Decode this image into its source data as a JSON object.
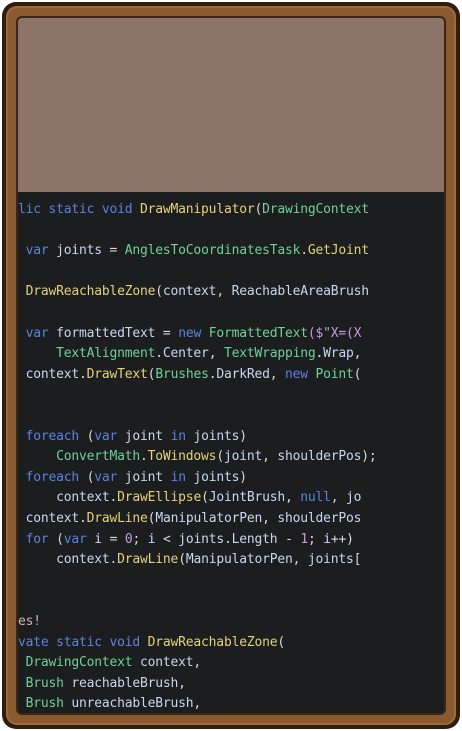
{
  "window": {
    "title": ""
  },
  "colors": {
    "frame": "#8a5a2e",
    "frame_dark": "#2f1e10",
    "header": "#8c7468",
    "code_bg": "#1b1d1e",
    "keyword": "#5b82e0",
    "type": "#6ed19a",
    "method": "#e3d27a",
    "identifier": "#c9d6f2",
    "plain": "#d8d8d8"
  },
  "code": {
    "lines": [
      {
        "segs": [
          {
            "t": "lic ",
            "c": "kw"
          },
          {
            "t": "static ",
            "c": "kw"
          },
          {
            "t": "void ",
            "c": "kw"
          },
          {
            "t": "DrawManipulator",
            "c": "meth"
          },
          {
            "t": "(",
            "c": "pl"
          },
          {
            "t": "DrawingContext",
            "c": "type"
          }
        ]
      },
      {
        "segs": [
          {
            "t": "",
            "c": "pl"
          }
        ]
      },
      {
        "segs": [
          {
            "t": " var ",
            "c": "kw"
          },
          {
            "t": "joints",
            "c": "id"
          },
          {
            "t": " = ",
            "c": "pl"
          },
          {
            "t": "AnglesToCoordinatesTask",
            "c": "type"
          },
          {
            "t": ".",
            "c": "pl"
          },
          {
            "t": "GetJoint",
            "c": "meth"
          }
        ]
      },
      {
        "segs": [
          {
            "t": "",
            "c": "pl"
          }
        ]
      },
      {
        "segs": [
          {
            "t": " DrawReachableZone",
            "c": "meth"
          },
          {
            "t": "(",
            "c": "pl"
          },
          {
            "t": "context",
            "c": "id"
          },
          {
            "t": ", ",
            "c": "pl"
          },
          {
            "t": "ReachableAreaBrush",
            "c": "id"
          }
        ]
      },
      {
        "segs": [
          {
            "t": "",
            "c": "pl"
          }
        ]
      },
      {
        "segs": [
          {
            "t": " var ",
            "c": "kw"
          },
          {
            "t": "formattedText",
            "c": "id"
          },
          {
            "t": " = ",
            "c": "pl"
          },
          {
            "t": "new ",
            "c": "kw"
          },
          {
            "t": "FormattedText",
            "c": "type"
          },
          {
            "t": "($\"X=(X",
            "c": "lit"
          }
        ]
      },
      {
        "segs": [
          {
            "t": "     TextAlignment",
            "c": "type"
          },
          {
            "t": ".",
            "c": "pl"
          },
          {
            "t": "Center",
            "c": "id"
          },
          {
            "t": ", ",
            "c": "pl"
          },
          {
            "t": "TextWrapping",
            "c": "type"
          },
          {
            "t": ".",
            "c": "pl"
          },
          {
            "t": "Wrap",
            "c": "id"
          },
          {
            "t": ",",
            "c": "pl"
          }
        ]
      },
      {
        "segs": [
          {
            "t": " context",
            "c": "id"
          },
          {
            "t": ".",
            "c": "pl"
          },
          {
            "t": "DrawText",
            "c": "meth"
          },
          {
            "t": "(",
            "c": "pl"
          },
          {
            "t": "Brushes",
            "c": "type"
          },
          {
            "t": ".",
            "c": "pl"
          },
          {
            "t": "DarkRed",
            "c": "id"
          },
          {
            "t": ", ",
            "c": "pl"
          },
          {
            "t": "new ",
            "c": "kw"
          },
          {
            "t": "Point",
            "c": "type"
          },
          {
            "t": "(",
            "c": "pl"
          }
        ]
      },
      {
        "segs": [
          {
            "t": "",
            "c": "pl"
          }
        ]
      },
      {
        "segs": [
          {
            "t": "",
            "c": "pl"
          }
        ]
      },
      {
        "segs": [
          {
            "t": " foreach ",
            "c": "kw"
          },
          {
            "t": "(",
            "c": "pl"
          },
          {
            "t": "var ",
            "c": "kw"
          },
          {
            "t": "joint ",
            "c": "id"
          },
          {
            "t": "in ",
            "c": "kw"
          },
          {
            "t": "joints",
            "c": "id"
          },
          {
            "t": ")",
            "c": "pl"
          }
        ]
      },
      {
        "segs": [
          {
            "t": "     ConvertMath",
            "c": "type"
          },
          {
            "t": ".",
            "c": "pl"
          },
          {
            "t": "ToWindows",
            "c": "meth"
          },
          {
            "t": "(",
            "c": "pl"
          },
          {
            "t": "joint",
            "c": "id"
          },
          {
            "t": ", ",
            "c": "pl"
          },
          {
            "t": "shoulderPos",
            "c": "id"
          },
          {
            "t": ");",
            "c": "pl"
          }
        ]
      },
      {
        "segs": [
          {
            "t": " foreach ",
            "c": "kw"
          },
          {
            "t": "(",
            "c": "pl"
          },
          {
            "t": "var ",
            "c": "kw"
          },
          {
            "t": "joint ",
            "c": "id"
          },
          {
            "t": "in ",
            "c": "kw"
          },
          {
            "t": "joints",
            "c": "id"
          },
          {
            "t": ")",
            "c": "pl"
          }
        ]
      },
      {
        "segs": [
          {
            "t": "     context",
            "c": "id"
          },
          {
            "t": ".",
            "c": "pl"
          },
          {
            "t": "DrawEllipse",
            "c": "meth"
          },
          {
            "t": "(",
            "c": "pl"
          },
          {
            "t": "JointBrush",
            "c": "id"
          },
          {
            "t": ", ",
            "c": "pl"
          },
          {
            "t": "null",
            "c": "kw"
          },
          {
            "t": ", jo",
            "c": "id"
          }
        ]
      },
      {
        "segs": [
          {
            "t": " context",
            "c": "id"
          },
          {
            "t": ".",
            "c": "pl"
          },
          {
            "t": "DrawLine",
            "c": "meth"
          },
          {
            "t": "(",
            "c": "pl"
          },
          {
            "t": "ManipulatorPen",
            "c": "id"
          },
          {
            "t": ", ",
            "c": "pl"
          },
          {
            "t": "shoulderPos",
            "c": "id"
          }
        ]
      },
      {
        "segs": [
          {
            "t": " for ",
            "c": "kw"
          },
          {
            "t": "(",
            "c": "pl"
          },
          {
            "t": "var ",
            "c": "kw"
          },
          {
            "t": "i",
            "c": "id"
          },
          {
            "t": " = ",
            "c": "pl"
          },
          {
            "t": "0",
            "c": "lit"
          },
          {
            "t": "; ",
            "c": "pl"
          },
          {
            "t": "i",
            "c": "id"
          },
          {
            "t": " < ",
            "c": "pl"
          },
          {
            "t": "joints",
            "c": "id"
          },
          {
            "t": ".",
            "c": "pl"
          },
          {
            "t": "Length",
            "c": "id"
          },
          {
            "t": " - ",
            "c": "pl"
          },
          {
            "t": "1",
            "c": "lit"
          },
          {
            "t": "; ",
            "c": "pl"
          },
          {
            "t": "i",
            "c": "id"
          },
          {
            "t": "++)",
            "c": "pl"
          }
        ]
      },
      {
        "segs": [
          {
            "t": "     context",
            "c": "id"
          },
          {
            "t": ".",
            "c": "pl"
          },
          {
            "t": "DrawLine",
            "c": "meth"
          },
          {
            "t": "(",
            "c": "pl"
          },
          {
            "t": "ManipulatorPen",
            "c": "id"
          },
          {
            "t": ", ",
            "c": "pl"
          },
          {
            "t": "joints",
            "c": "id"
          },
          {
            "t": "[",
            "c": "pl"
          }
        ]
      },
      {
        "segs": [
          {
            "t": "",
            "c": "pl"
          }
        ]
      },
      {
        "segs": [
          {
            "t": "",
            "c": "pl"
          }
        ]
      },
      {
        "segs": [
          {
            "t": "es!",
            "c": "cmt"
          }
        ]
      },
      {
        "segs": [
          {
            "t": "vate ",
            "c": "kw"
          },
          {
            "t": "static ",
            "c": "kw"
          },
          {
            "t": "void ",
            "c": "kw"
          },
          {
            "t": "DrawReachableZone",
            "c": "meth"
          },
          {
            "t": "(",
            "c": "pl"
          }
        ]
      },
      {
        "segs": [
          {
            "t": " DrawingContext ",
            "c": "type"
          },
          {
            "t": "context",
            "c": "id"
          },
          {
            "t": ",",
            "c": "pl"
          }
        ]
      },
      {
        "segs": [
          {
            "t": " Brush ",
            "c": "type"
          },
          {
            "t": "reachableBrush",
            "c": "id"
          },
          {
            "t": ",",
            "c": "pl"
          }
        ]
      },
      {
        "segs": [
          {
            "t": " Brush ",
            "c": "type"
          },
          {
            "t": "unreachableBrush",
            "c": "id"
          },
          {
            "t": ",",
            "c": "pl"
          }
        ]
      }
    ]
  }
}
